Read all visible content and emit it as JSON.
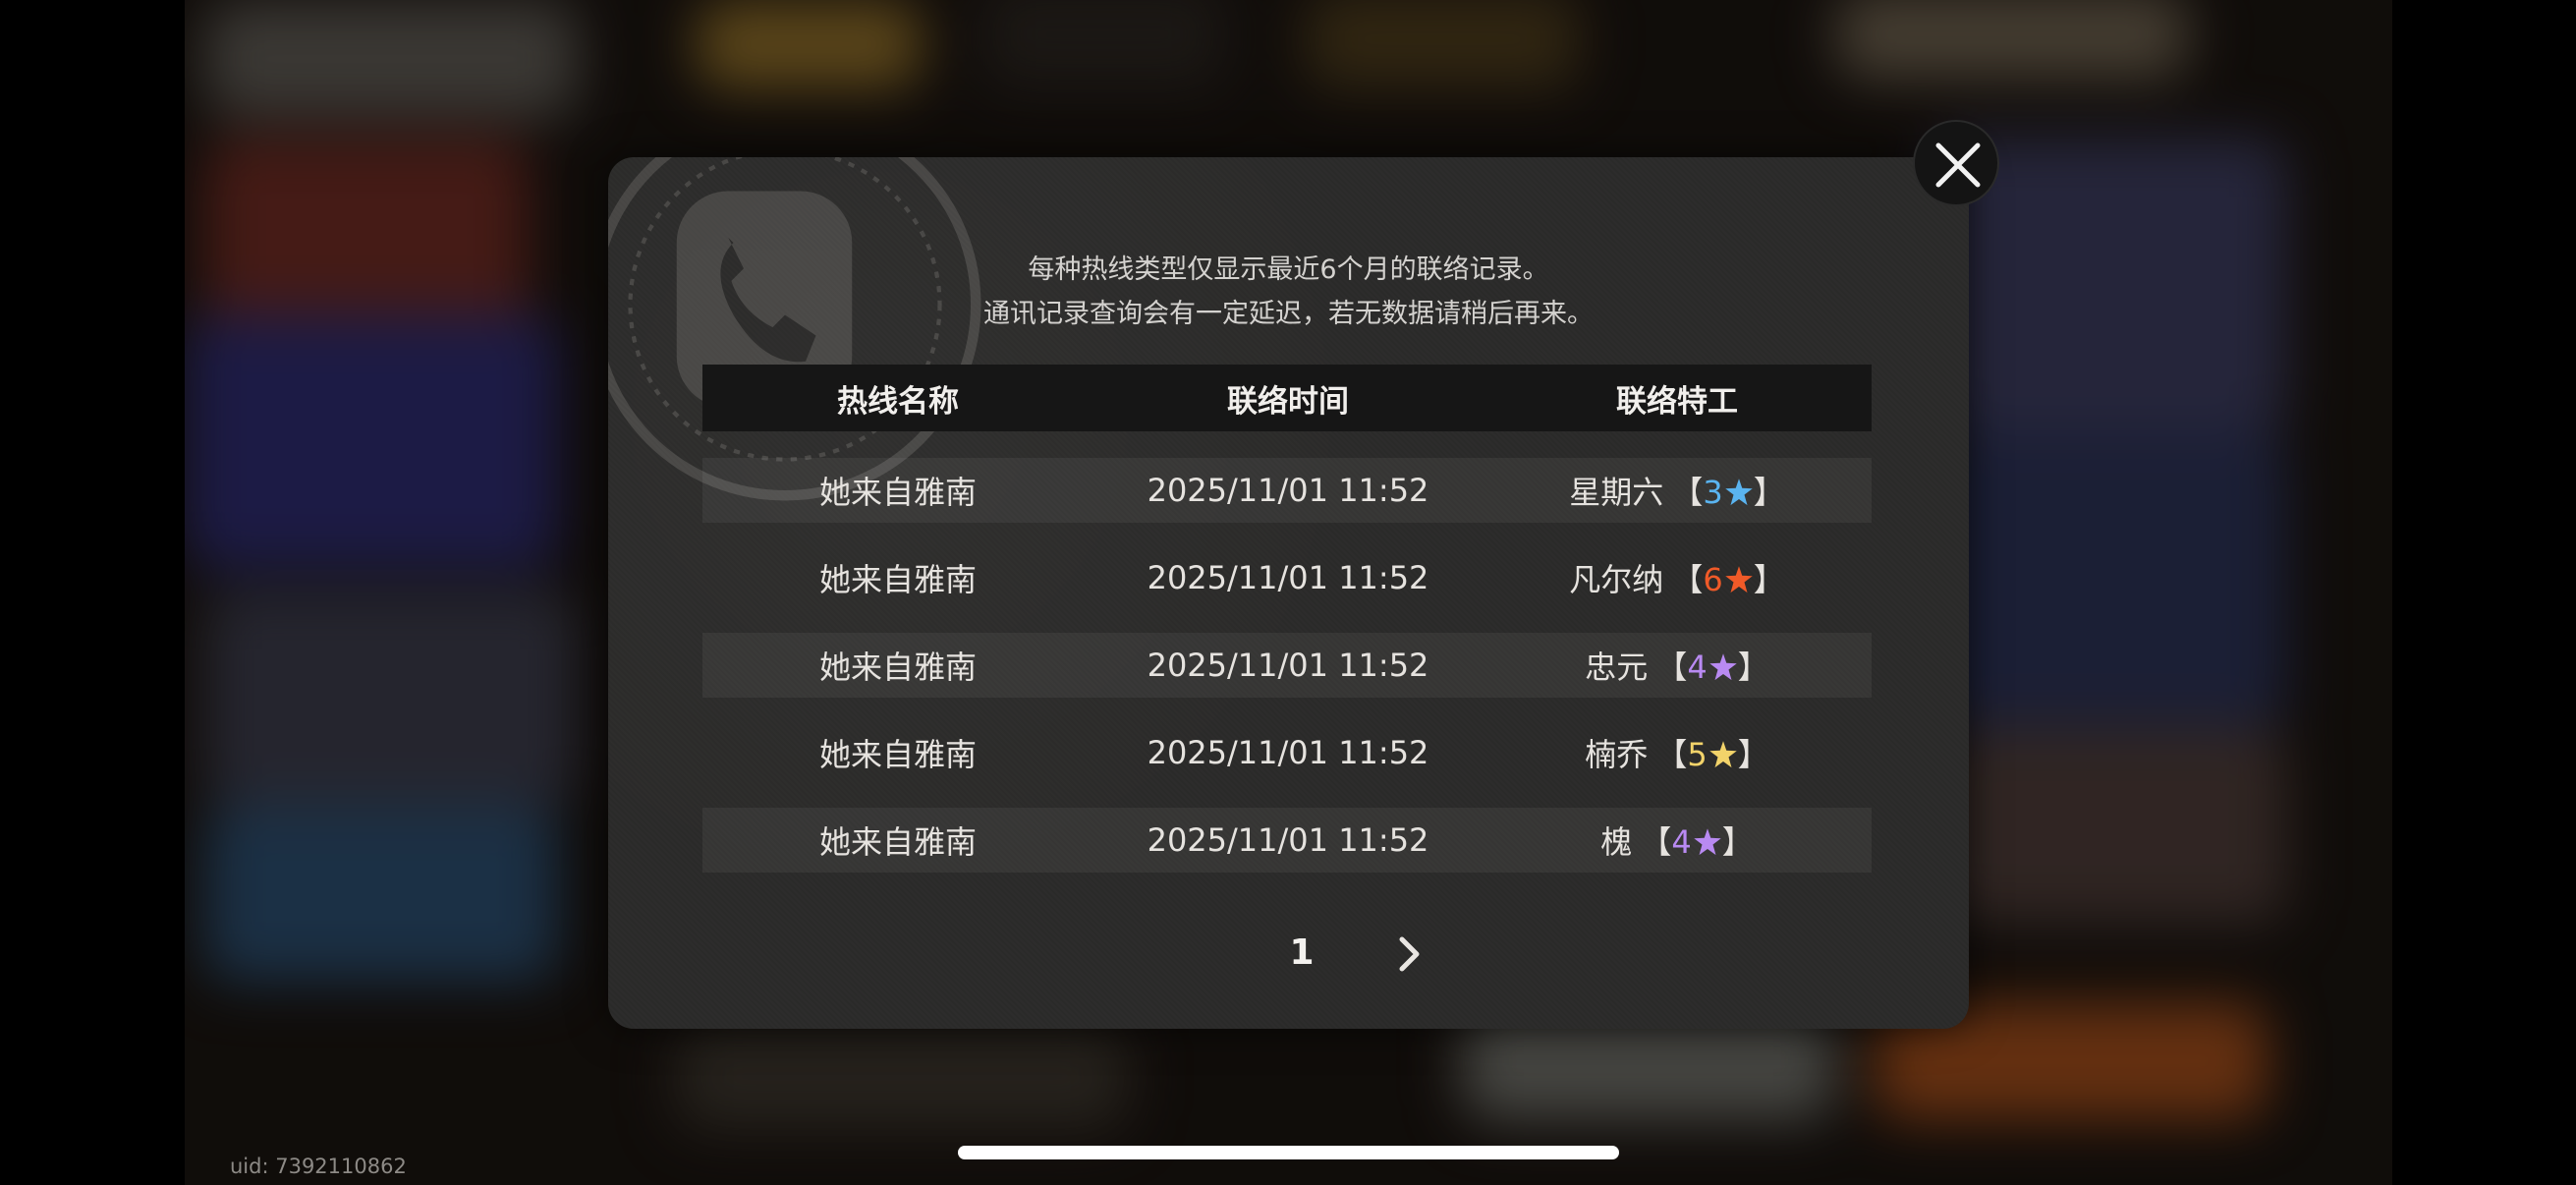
{
  "notice": {
    "line1": "每种热线类型仅显示最近6个月的联络记录。",
    "line2": "通讯记录查询会有一定延迟，若无数据请稍后再来。"
  },
  "table": {
    "headers": [
      "热线名称",
      "联络时间",
      "联络特工"
    ],
    "rows": [
      {
        "hotline": "她来自雅南",
        "time": "2025/11/01 11:52",
        "agent": "星期六",
        "bracket_open": "【",
        "rank": "3",
        "bracket_close": "】",
        "rank_color": "#5ab4f0",
        "star_icon": "blue-star-icon"
      },
      {
        "hotline": "她来自雅南",
        "time": "2025/11/01 11:52",
        "agent": "凡尔纳",
        "bracket_open": "【",
        "rank": "6",
        "bracket_close": "】",
        "rank_color": "#f05a28",
        "star_icon": "red-star-icon"
      },
      {
        "hotline": "她来自雅南",
        "time": "2025/11/01 11:52",
        "agent": "忠元",
        "bracket_open": "【",
        "rank": "4",
        "bracket_close": "】",
        "rank_color": "#b98af2",
        "star_icon": "purple-star-icon"
      },
      {
        "hotline": "她来自雅南",
        "time": "2025/11/01 11:52",
        "agent": "楠乔",
        "bracket_open": "【",
        "rank": "5",
        "bracket_close": "】",
        "rank_color": "#f2d36a",
        "star_icon": "gold-star-icon"
      },
      {
        "hotline": "她来自雅南",
        "time": "2025/11/01 11:52",
        "agent": "槐",
        "bracket_open": "【",
        "rank": "4",
        "bracket_close": "】",
        "rank_color": "#b98af2",
        "star_icon": "purple-star-icon"
      }
    ]
  },
  "pager": {
    "current_page": "1"
  },
  "footer": {
    "uid": "uid: 7392110862"
  },
  "colors": {
    "dialog_bg": "#2b2a29",
    "header_bg": "#161616",
    "text": "#e6e3df"
  }
}
